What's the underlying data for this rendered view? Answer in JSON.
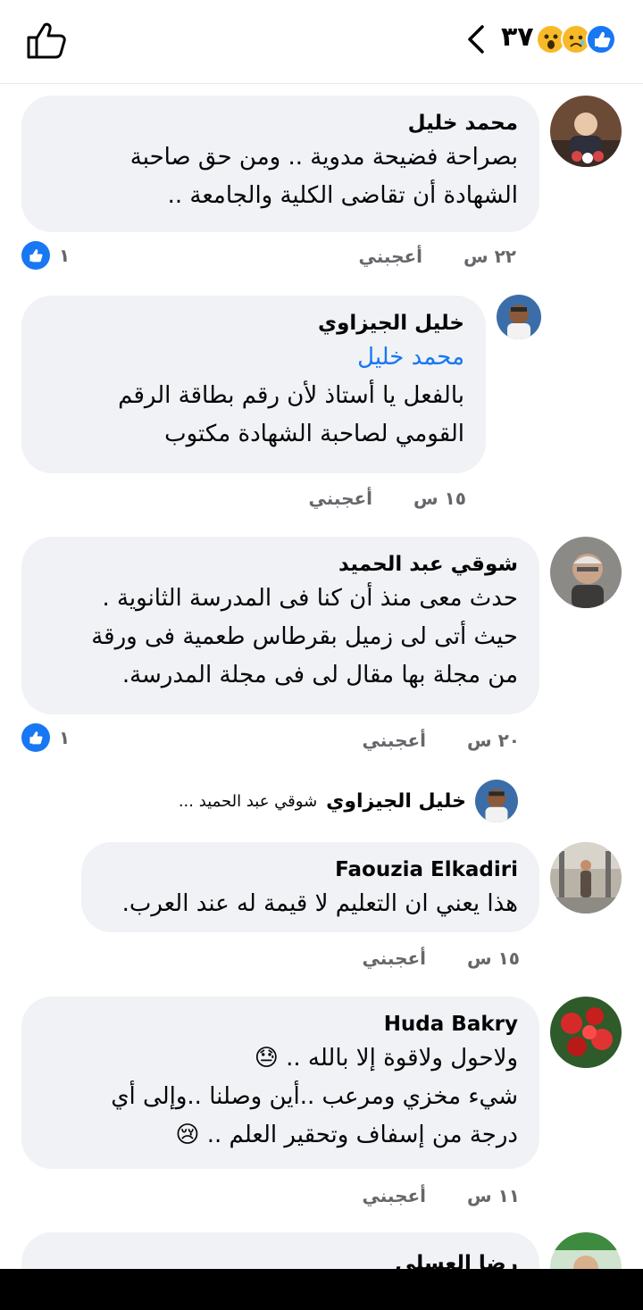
{
  "header": {
    "reaction_count": "٣٧",
    "reactions": [
      "like",
      "sad",
      "wow"
    ]
  },
  "comments": [
    {
      "author": "محمد خليل",
      "lines": [
        "بصراحة فضيحة مدوية .. ومن حق صاحبة",
        "الشهادة أن تقاضى الكلية والجامعة .."
      ],
      "time": "٢٢ س",
      "like_label": "أعجبني",
      "reaction_count": "١"
    },
    {
      "author": "خليل الجيزاوي",
      "mention": "محمد خليل",
      "lines": [
        "بالفعل يا أستاذ لأن رقم بطاقة الرقم",
        "القومي لصاحبة الشهادة مكتوب"
      ],
      "time": "١٥ س",
      "like_label": "أعجبني"
    },
    {
      "author": "شوقي عبد الحميد",
      "lines": [
        "حدث معى منذ  أن كنا فى المدرسة الثانوية .",
        "حيث أتى لى زميل بقرطاس طعمية فى ورقة",
        "من مجلة بها مقال لى فى مجلة المدرسة."
      ],
      "time": "٢٠ س",
      "like_label": "أعجبني",
      "reaction_count": "١"
    },
    {
      "author": "Faouzia Elkadiri",
      "lines": [
        "هذا يعني ان التعليم لا قيمة له عند العرب."
      ],
      "time": "١٥ س",
      "like_label": "أعجبني"
    },
    {
      "author": "Huda Bakry",
      "lines": [
        "ولاحول ولاقوة إلا بالله .. 😓",
        "شيء مخزي ومرعب ..أين وصلنا ..وإلى أي",
        "درجة من إسفاف وتحقير العلم .. 😢"
      ],
      "time": "١١ س",
      "like_label": "أعجبني"
    }
  ],
  "reply_preview": {
    "author": "خليل الجيزاوي",
    "text": "شوقي عبد الحميد ..."
  },
  "partial_comment": {
    "author": "رضا العسلي"
  },
  "colors": {
    "accent": "#1877f2",
    "bubble": "#f0f2f5",
    "meta": "#65676b"
  }
}
